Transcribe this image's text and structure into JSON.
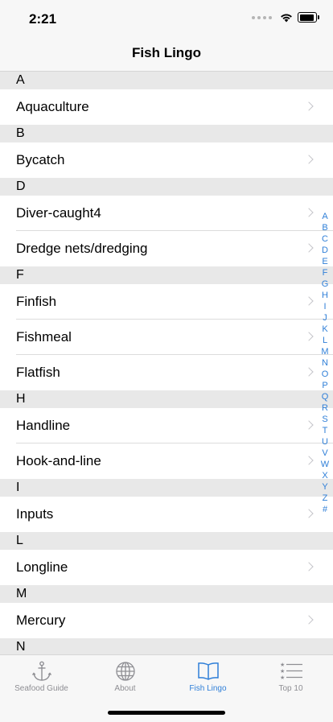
{
  "status": {
    "time": "2:21"
  },
  "nav": {
    "title": "Fish Lingo"
  },
  "sections": [
    {
      "letter": "A",
      "items": [
        "Aquaculture"
      ]
    },
    {
      "letter": "B",
      "items": [
        "Bycatch"
      ]
    },
    {
      "letter": "D",
      "items": [
        "Diver-caught4",
        "Dredge nets/dredging"
      ]
    },
    {
      "letter": "F",
      "items": [
        "Finfish",
        "Fishmeal",
        "Flatfish"
      ]
    },
    {
      "letter": "H",
      "items": [
        "Handline",
        "Hook-and-line"
      ]
    },
    {
      "letter": "I",
      "items": [
        "Inputs"
      ]
    },
    {
      "letter": "L",
      "items": [
        "Longline"
      ]
    },
    {
      "letter": "M",
      "items": [
        "Mercury"
      ]
    },
    {
      "letter": "N",
      "items": []
    }
  ],
  "index_letters": [
    "A",
    "B",
    "C",
    "D",
    "E",
    "F",
    "G",
    "H",
    "I",
    "J",
    "K",
    "L",
    "M",
    "N",
    "O",
    "P",
    "Q",
    "R",
    "S",
    "T",
    "U",
    "V",
    "W",
    "X",
    "Y",
    "Z",
    "#"
  ],
  "tabs": [
    {
      "label": "Seafood Guide",
      "icon": "anchor-icon",
      "active": false
    },
    {
      "label": "About",
      "icon": "globe-icon",
      "active": false
    },
    {
      "label": "Fish Lingo",
      "icon": "book-icon",
      "active": true
    },
    {
      "label": "Top 10",
      "icon": "ranked-list-icon",
      "active": false
    }
  ],
  "colors": {
    "accent": "#2f7fd8",
    "inactive": "#8e8e93",
    "section_bg": "#e8e8e8"
  }
}
